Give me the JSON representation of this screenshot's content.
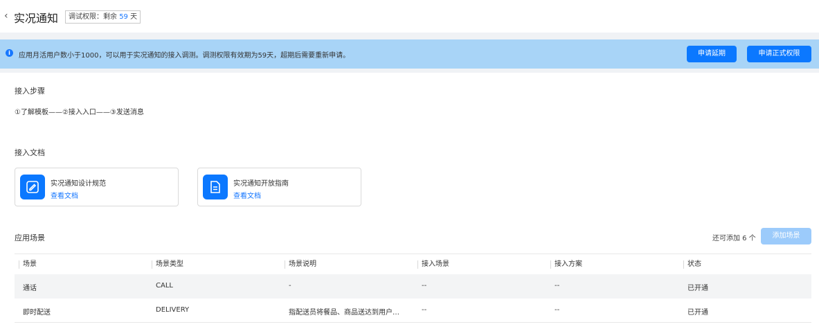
{
  "header": {
    "back_icon": "chevron-left-icon",
    "title": "实况通知",
    "debug_prefix": "调试权限：剩余",
    "debug_days": "59",
    "debug_suffix": "天"
  },
  "banner": {
    "icon": "info-icon",
    "text": "应用月活用户数小于1000，可以用于实况通知的接入调测。调测权限有效期为59天，超期后需要重新申请。",
    "extend_button": "申请延期",
    "official_button": "申请正式权限"
  },
  "steps": {
    "title": "接入步骤",
    "text": "①了解模板——②接入入口——③发送消息"
  },
  "docs": {
    "title": "接入文档",
    "items": [
      {
        "name": "实况通知设计规范",
        "link": "查看文档",
        "icon": "edit-document-icon"
      },
      {
        "name": "实况通知开放指南",
        "link": "查看文档",
        "icon": "document-icon"
      }
    ]
  },
  "scenes": {
    "title": "应用场景",
    "remain_text": "还可添加 6 个",
    "add_button": "添加场景",
    "columns": [
      "场景",
      "场景类型",
      "场景说明",
      "接入场景",
      "接入方案",
      "状态"
    ],
    "rows": [
      [
        "通话",
        "CALL",
        "-",
        "--",
        "--",
        "已开通"
      ],
      [
        "即时配送",
        "DELIVERY",
        "指配送员将餐品、商品送达到用户…",
        "--",
        "--",
        "已开通"
      ]
    ]
  },
  "colors": {
    "primary": "#0b78ff",
    "banner_bg": "#a8d4f7",
    "disabled_button": "#9ccbfb",
    "link": "#1677ff"
  }
}
